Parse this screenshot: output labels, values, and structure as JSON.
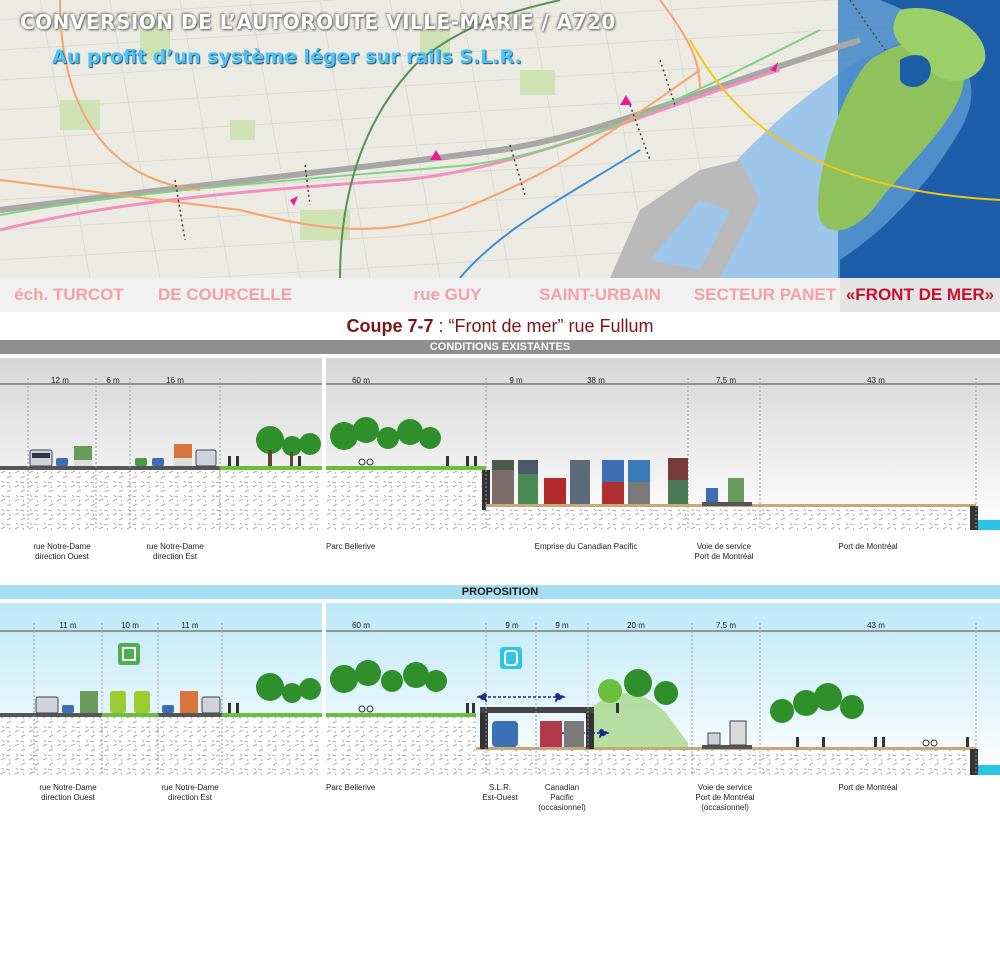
{
  "title": {
    "line1": "CONVERSION DE L’AUTOROUTE VILLE-MARIE / A720",
    "line2": "Au profit d’un système léger sur rails S.L.R."
  },
  "tabs": [
    {
      "label": "éch. TURCOT",
      "active": false
    },
    {
      "label": "DE COURCELLE",
      "active": false
    },
    {
      "label": "rue GUY",
      "active": false
    },
    {
      "label": "SAINT-URBAIN",
      "active": false
    },
    {
      "label": "SECTEUR PANET",
      "active": false
    },
    {
      "label": "«FRONT DE MER»",
      "active": true
    }
  ],
  "coupe": {
    "prefix": "Coupe 7-7",
    "rest": " : “Front de mer” rue Fullum"
  },
  "existing": {
    "header": "CONDITIONS EXISTANTES",
    "left_dims": [
      "12 m",
      "6 m",
      "16 m"
    ],
    "right_dims": [
      "60 m",
      "9 m",
      "38 m",
      "7,5 m",
      "43 m"
    ],
    "left_labels": [
      {
        "l1": "rue Notre-Dame",
        "l2": "direction Ouest"
      },
      {
        "l1": "rue Notre-Dame",
        "l2": "direction Est"
      }
    ],
    "right_labels": [
      {
        "l1": "Parc Bellerive",
        "l2": ""
      },
      {
        "l1": "Emprise du Canadian Pacific",
        "l2": ""
      },
      {
        "l1": "Voie de service",
        "l2": "Port de Montréal"
      },
      {
        "l1": "Port de Montréal",
        "l2": ""
      }
    ]
  },
  "proposal": {
    "header": "PROPOSITION",
    "left_dims": [
      "11 m",
      "10 m",
      "11 m"
    ],
    "right_dims": [
      "60 m",
      "9 m",
      "9 m",
      "20 m",
      "7,5 m",
      "43 m"
    ],
    "left_labels": [
      {
        "l1": "rue Notre-Dame",
        "l2": "direction Ouest"
      },
      {
        "l1": "rue Notre-Dame",
        "l2": "direction Est"
      }
    ],
    "right_labels": [
      {
        "l1": "Parc Bellerive",
        "l2": "",
        "l3": ""
      },
      {
        "l1": "S.L.R.",
        "l2": "Est-Ouest",
        "l3": ""
      },
      {
        "l1": "Canadian",
        "l2": "Pacific",
        "l3": "(occasionnel)"
      },
      {
        "l1": "Voie de service",
        "l2": "Port de Montréal",
        "l3": "(occasionnel)"
      },
      {
        "l1": "Port de Montréal",
        "l2": "",
        "l3": ""
      }
    ]
  },
  "colors": {
    "accent_red": "#c8102e",
    "tab_inactive": "#f2a1a6",
    "coupe_title": "#7b1616",
    "grass": "#6cbf3a",
    "tree": "#2f8f2a",
    "water": "#8fc1e6",
    "sky_existing": "#ececec",
    "sky_proposal": "#d8f1fa",
    "proposal_bar": "#a7dff2",
    "existing_bar": "#8f8f8f",
    "slr_icon": "#2ec4e8",
    "tram_icon": "#4caf50"
  },
  "icons": [
    "tram-icon",
    "slr-icon",
    "tree-icon",
    "pedestrian-icon",
    "cyclist-icon",
    "truck-icon",
    "bus-icon",
    "car-icon",
    "train-icon",
    "container-icon"
  ]
}
